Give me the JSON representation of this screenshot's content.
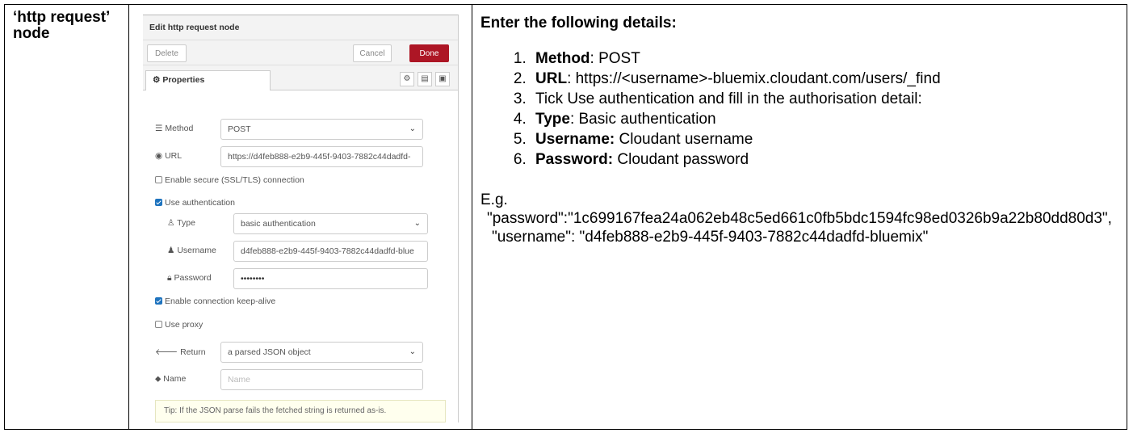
{
  "row": {
    "label": "‘http request’ node"
  },
  "node_editor": {
    "title": "Edit http request node",
    "buttons": {
      "delete": "Delete",
      "cancel": "Cancel",
      "done": "Done"
    },
    "tab": "Properties",
    "method": {
      "label": "Method",
      "value": "POST"
    },
    "url": {
      "label": "URL",
      "value": "https://d4feb888-e2b9-445f-9403-7882c44dadfd-"
    },
    "enable_secure": {
      "label": "Enable secure (SSL/TLS) connection",
      "checked": false
    },
    "use_auth": {
      "label": "Use authentication",
      "checked": true
    },
    "type": {
      "label": "Type",
      "value": "basic authentication"
    },
    "username": {
      "label": "Username",
      "value": "d4feb888-e2b9-445f-9403-7882c44dadfd-blue"
    },
    "password": {
      "label": "Password",
      "value": "••••••••"
    },
    "keep_alive": {
      "label": "Enable connection keep-alive",
      "checked": true
    },
    "use_proxy": {
      "label": "Use proxy",
      "checked": false
    },
    "return": {
      "label": "Return",
      "value": "a parsed JSON object"
    },
    "name": {
      "label": "Name",
      "placeholder": "Name"
    },
    "tip": "Tip: If the JSON parse fails the fetched string is returned as-is.",
    "colors": {
      "done_button": "#ad1625",
      "checkbox": "#1e73be",
      "tip_bg": "#ffffee"
    }
  },
  "instructions": {
    "heading": "Enter the following details:",
    "steps": [
      {
        "bold": "Method",
        "text": ": POST"
      },
      {
        "bold": "URL",
        "text": ": https://<username>-bluemix.cloudant.com/users/_find"
      },
      {
        "bold": "",
        "text": "Tick Use authentication and fill in the authorisation detail:"
      },
      {
        "bold": "Type",
        "text": ": Basic authentication"
      },
      {
        "bold": "Username:",
        "text": " Cloudant username"
      },
      {
        "bold": "Password:",
        "text": " Cloudant password"
      }
    ],
    "example_label": "E.g.",
    "example_password": "\"password\":\"1c699167fea24a062eb48c5ed661c0fb5bdc1594fc98ed0326b9a22b80dd80d3\",",
    "example_username": "\"username\": \"d4feb888-e2b9-445f-9403-7882c44dadfd-bluemix\""
  }
}
